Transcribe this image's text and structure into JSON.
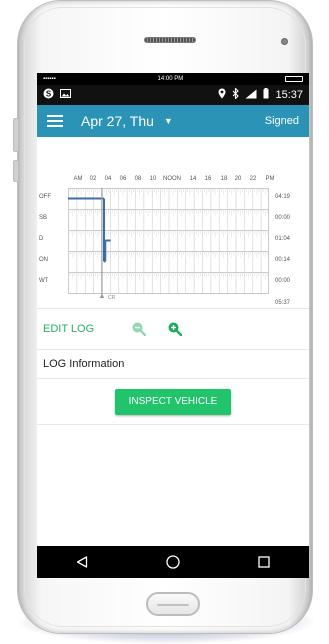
{
  "device": {
    "top_bar": {
      "left_dots": "▪▪▪▪▪▪",
      "time": "14:00 PM"
    }
  },
  "status_bar": {
    "left_icons": [
      "skype-icon",
      "image-icon"
    ],
    "right_icons": [
      "location-icon",
      "bluetooth-icon",
      "signal-icon",
      "battery-icon"
    ],
    "time": "15:37"
  },
  "app_bar": {
    "date": "Apr 27, Thu",
    "status": "Signed",
    "color": "#2b93b6"
  },
  "log_graph": {
    "hour_labels": [
      "AM",
      "02",
      "04",
      "06",
      "08",
      "10",
      "NOON",
      "14",
      "16",
      "18",
      "20",
      "22",
      "PM"
    ],
    "rows": [
      {
        "label": "OFF",
        "total": "04:19"
      },
      {
        "label": "SB",
        "total": "00:00"
      },
      {
        "label": "D",
        "total": "01:04"
      },
      {
        "label": "ON",
        "total": "00:14"
      },
      {
        "label": "WT",
        "total": "00:00"
      }
    ],
    "grand_total": "05:37",
    "cursor_label": "CR",
    "line_color": "#3a6ea8",
    "segments_hours": [
      {
        "status": "OFF",
        "start": 0,
        "end": 4.3
      },
      {
        "status": "D",
        "start": 4.45,
        "end": 5.1
      },
      {
        "status": "ON",
        "start": 4.3,
        "end": 4.45
      }
    ]
  },
  "actions": {
    "edit_log": "EDIT LOG",
    "zoom_out_icon": "zoom-out-icon",
    "zoom_in_icon": "zoom-in-icon"
  },
  "log_info": {
    "title": "LOG Information"
  },
  "inspect": {
    "label": "INSPECT VEHICLE",
    "color": "#21c46a"
  },
  "nav": {
    "icons": [
      "back-icon",
      "home-icon",
      "recents-icon"
    ]
  }
}
